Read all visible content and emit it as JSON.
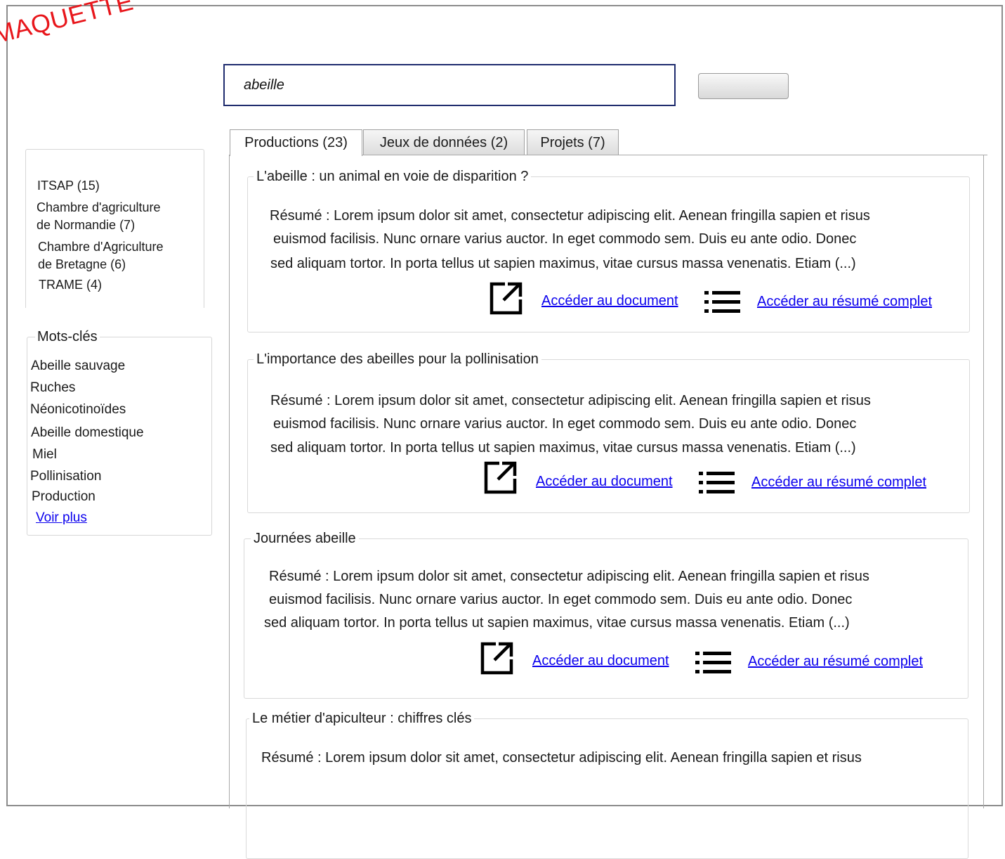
{
  "watermark": "MAQUETTE",
  "search": {
    "value": "abeille",
    "button_label": ""
  },
  "facets": [
    {
      "label": "ITSAP (15)"
    },
    {
      "label": "Chambre d'agriculture\nde Normandie (7)"
    },
    {
      "label": "Chambre d'Agriculture\nde Bretagne (6)"
    },
    {
      "label": "TRAME (4)"
    }
  ],
  "keywords": {
    "legend": "Mots-clés",
    "items": [
      "Abeille sauvage",
      "Ruches",
      "Néonicotinoïdes",
      "Abeille domestique",
      "Miel",
      "Pollinisation",
      "Production"
    ],
    "more_label": "Voir plus"
  },
  "tabs": [
    {
      "label": "Productions (23)",
      "active": true
    },
    {
      "label": "Jeux de données (2)",
      "active": false
    },
    {
      "label": "Projets (7)",
      "active": false
    }
  ],
  "results": [
    {
      "title": "L'abeille : un animal en voie de disparition ?",
      "abstract": [
        "Résumé : Lorem ipsum dolor sit amet, consectetur adipiscing elit. Aenean fringilla sapien et risus",
        "euismod facilisis. Nunc ornare varius auctor. In eget commodo sem. Duis eu ante odio. Donec",
        "sed aliquam tortor. In porta tellus ut sapien maximus, vitae cursus massa venenatis. Etiam (...)"
      ],
      "doc_link": "Accéder au document",
      "summary_link": "Accéder au résumé complet"
    },
    {
      "title": "L'importance des abeilles pour la pollinisation",
      "abstract": [
        "Résumé : Lorem ipsum dolor sit amet, consectetur adipiscing elit. Aenean fringilla sapien et risus",
        "euismod facilisis. Nunc ornare varius auctor. In eget commodo sem. Duis eu ante odio. Donec",
        "sed aliquam tortor. In porta tellus ut sapien maximus, vitae cursus massa venenatis. Etiam (...)"
      ],
      "doc_link": "Accéder au document",
      "summary_link": "Accéder au résumé complet"
    },
    {
      "title": "Journées abeille",
      "abstract": [
        "Résumé : Lorem ipsum dolor sit amet, consectetur adipiscing elit. Aenean fringilla sapien et risus",
        "euismod facilisis. Nunc ornare varius auctor. In eget commodo sem. Duis eu ante odio. Donec",
        "sed aliquam tortor. In porta tellus ut sapien maximus, vitae cursus massa venenatis. Etiam  (...)"
      ],
      "doc_link": "Accéder au document",
      "summary_link": "Accéder au résumé complet"
    },
    {
      "title": "Le métier d'apiculteur : chiffres clés",
      "abstract": [
        "Résumé : Lorem ipsum dolor sit amet, consectetur adipiscing elit. Aenean fringilla sapien et risus"
      ]
    }
  ]
}
